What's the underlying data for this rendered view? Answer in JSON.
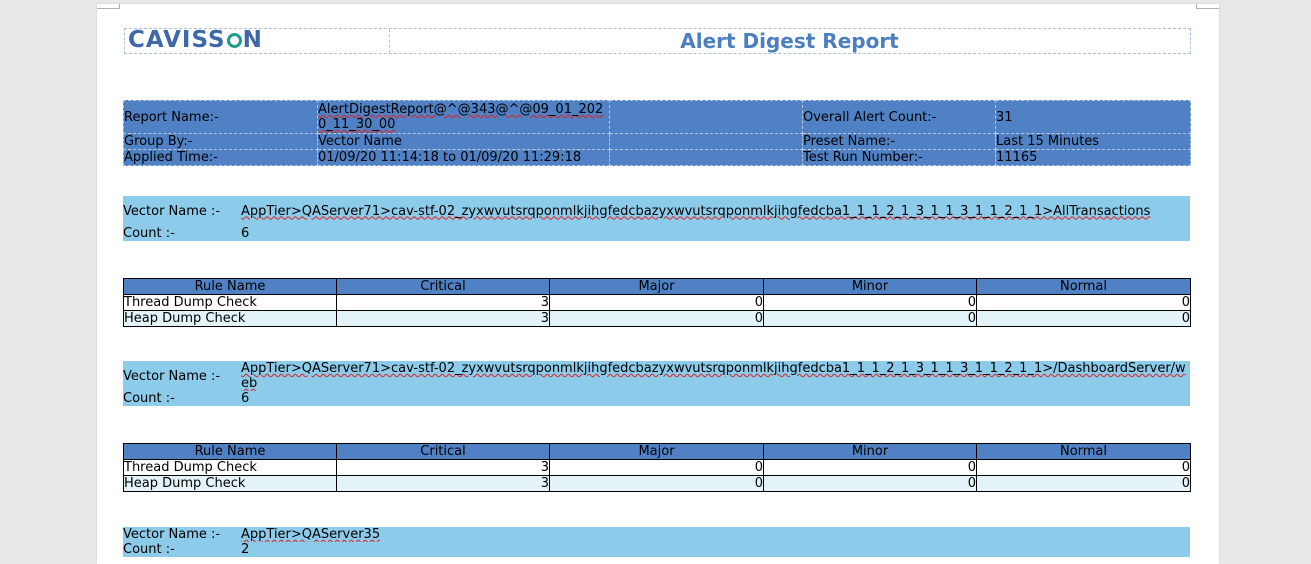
{
  "header": {
    "logo_text_1": "CAVISS",
    "logo_text_2": "N",
    "title": "Alert Digest Report"
  },
  "summary": {
    "report_name_label": "Report Name:-",
    "report_name_value": "AlertDigestReport@^@343@^@09_01_2020_11_30_00",
    "overall_alert_count_label": "Overall Alert Count:-",
    "overall_alert_count_value": "31",
    "group_by_label": "Group By:-",
    "group_by_value": "Vector Name",
    "preset_name_label": "Preset Name:-",
    "preset_name_value": "Last 15 Minutes",
    "applied_time_label": "Applied Time:-",
    "applied_time_value": "01/09/20 11:14:18 to 01/09/20 11:29:18",
    "test_run_number_label": "Test Run Number:-",
    "test_run_number_value": "11165"
  },
  "labels": {
    "vector_name": "Vector Name :-",
    "count": "Count :-"
  },
  "rule_table_headers": [
    "Rule Name",
    "Critical",
    "Major",
    "Minor",
    "Normal"
  ],
  "vectors": [
    {
      "name": "AppTier>QAServer71>cav-stf-02_zyxwvutsrqponmlkjihgfedcbazyxwvutsrqponmlkjihgfedcba1_1_1_2_1_3_1_1_3_1_1_2_1_1>AllTransactions",
      "count": "6",
      "rules": [
        {
          "rule": "Thread Dump Check",
          "critical": "3",
          "major": "0",
          "minor": "0",
          "normal": "0"
        },
        {
          "rule": "Heap Dump Check",
          "critical": "3",
          "major": "0",
          "minor": "0",
          "normal": "0"
        }
      ]
    },
    {
      "name": "AppTier>QAServer71>cav-stf-02_zyxwvutsrqponmlkjihgfedcbazyxwvutsrqponmlkjihgfedcba1_1_1_2_1_3_1_1_3_1_1_2_1_1>/DashboardServer/web",
      "count": "6",
      "rules": [
        {
          "rule": "Thread Dump Check",
          "critical": "3",
          "major": "0",
          "minor": "0",
          "normal": "0"
        },
        {
          "rule": "Heap Dump Check",
          "critical": "3",
          "major": "0",
          "minor": "0",
          "normal": "0"
        }
      ]
    },
    {
      "name": "AppTier>QAServer35",
      "count": "2",
      "rules": []
    }
  ]
}
